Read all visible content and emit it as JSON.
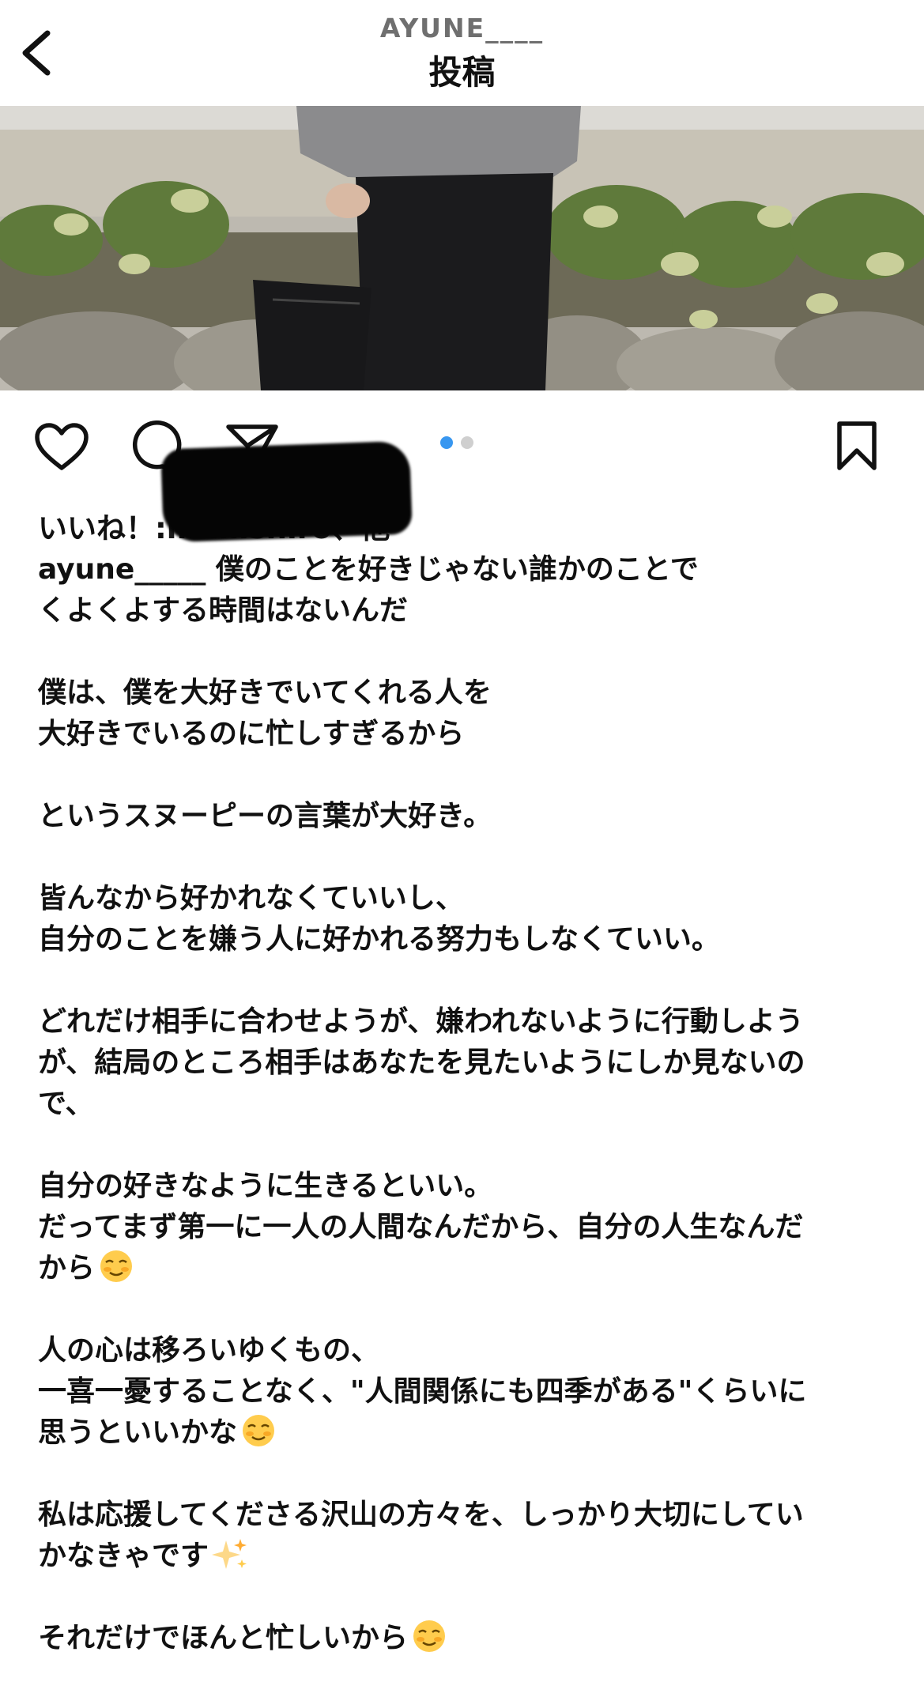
{
  "header": {
    "username": "AYUNE____",
    "title": "投稿"
  },
  "icons": {
    "back": "chevron-left-icon",
    "like": "heart-icon",
    "comment": "comment-bubble-icon",
    "share": "paper-plane-icon",
    "save": "bookmark-icon"
  },
  "carousel": {
    "total": 2,
    "current": 1,
    "active_color": "#3897f0",
    "inactive_color": "#cfcfcf"
  },
  "likes": {
    "prefix": "いいね！:",
    "masked_name": "m.mishiro",
    "suffix": "、他"
  },
  "caption": {
    "username": "ayune_____",
    "paragraphs": [
      [
        "僕のことを好きじゃない誰かのことで",
        "くよくよする時間はないんだ"
      ],
      [
        "僕は、僕を大好きでいてくれる人を",
        "大好きでいるのに忙しすぎるから"
      ],
      [
        "というスヌーピーの言葉が大好き。"
      ],
      [
        "皆んなから好かれなくていいし、",
        "自分のことを嫌う人に好かれる努力もしなくていい。"
      ],
      [
        "どれだけ相手に合わせようが、嫌われないように行動しよう",
        "が、結局のところ相手はあなたを見たいようにしか見ないの",
        "で、"
      ],
      [
        "自分の好きなように生きるといい。",
        "だってまず第一に一人の人間なんだから、自分の人生なんだ",
        "から"
      ],
      [
        "人の心は移ろいゆくもの、",
        "一喜一憂することなく、\"人間関係にも四季がある\"くらいに",
        "思うといいかな"
      ],
      [
        "私は応援してくださる沢山の方々を、しっかり大切にしてい",
        "かなきゃです"
      ],
      [
        "それだけでほんと忙しいから"
      ]
    ]
  }
}
